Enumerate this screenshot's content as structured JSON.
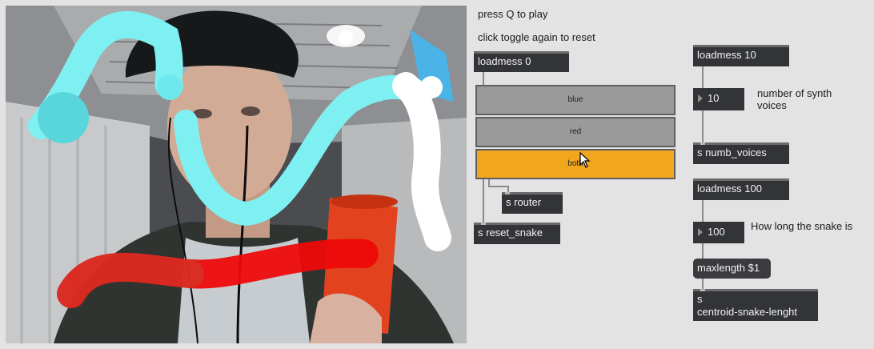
{
  "comments": {
    "press_q": "press Q to play",
    "click_toggle": "click toggle again to reset",
    "synth_voices": "number of synth voices",
    "snake_length": "How long the snake is"
  },
  "objects": {
    "loadmess_0": "loadmess 0",
    "loadmess_10": "loadmess 10",
    "loadmess_100": "loadmess 100",
    "s_router": "s router",
    "s_reset_snake": "s reset_snake",
    "s_numb_voices": "s numb_voices",
    "maxlength": "maxlength $1",
    "s_centroid_line1": "s",
    "s_centroid_line2": "centroid-snake-lenght"
  },
  "numbers": {
    "voices": "10",
    "length": "100"
  },
  "buttons": {
    "blue": "blue",
    "red": "red",
    "both": "both",
    "selected": "both"
  },
  "colors": {
    "cyan_snake": "#7ff0f2",
    "white_snake": "#ffffff",
    "red_snake": "#ee0a0a",
    "toggle_active": "#f0a71e",
    "patch_bg": "#e3e3e3"
  }
}
